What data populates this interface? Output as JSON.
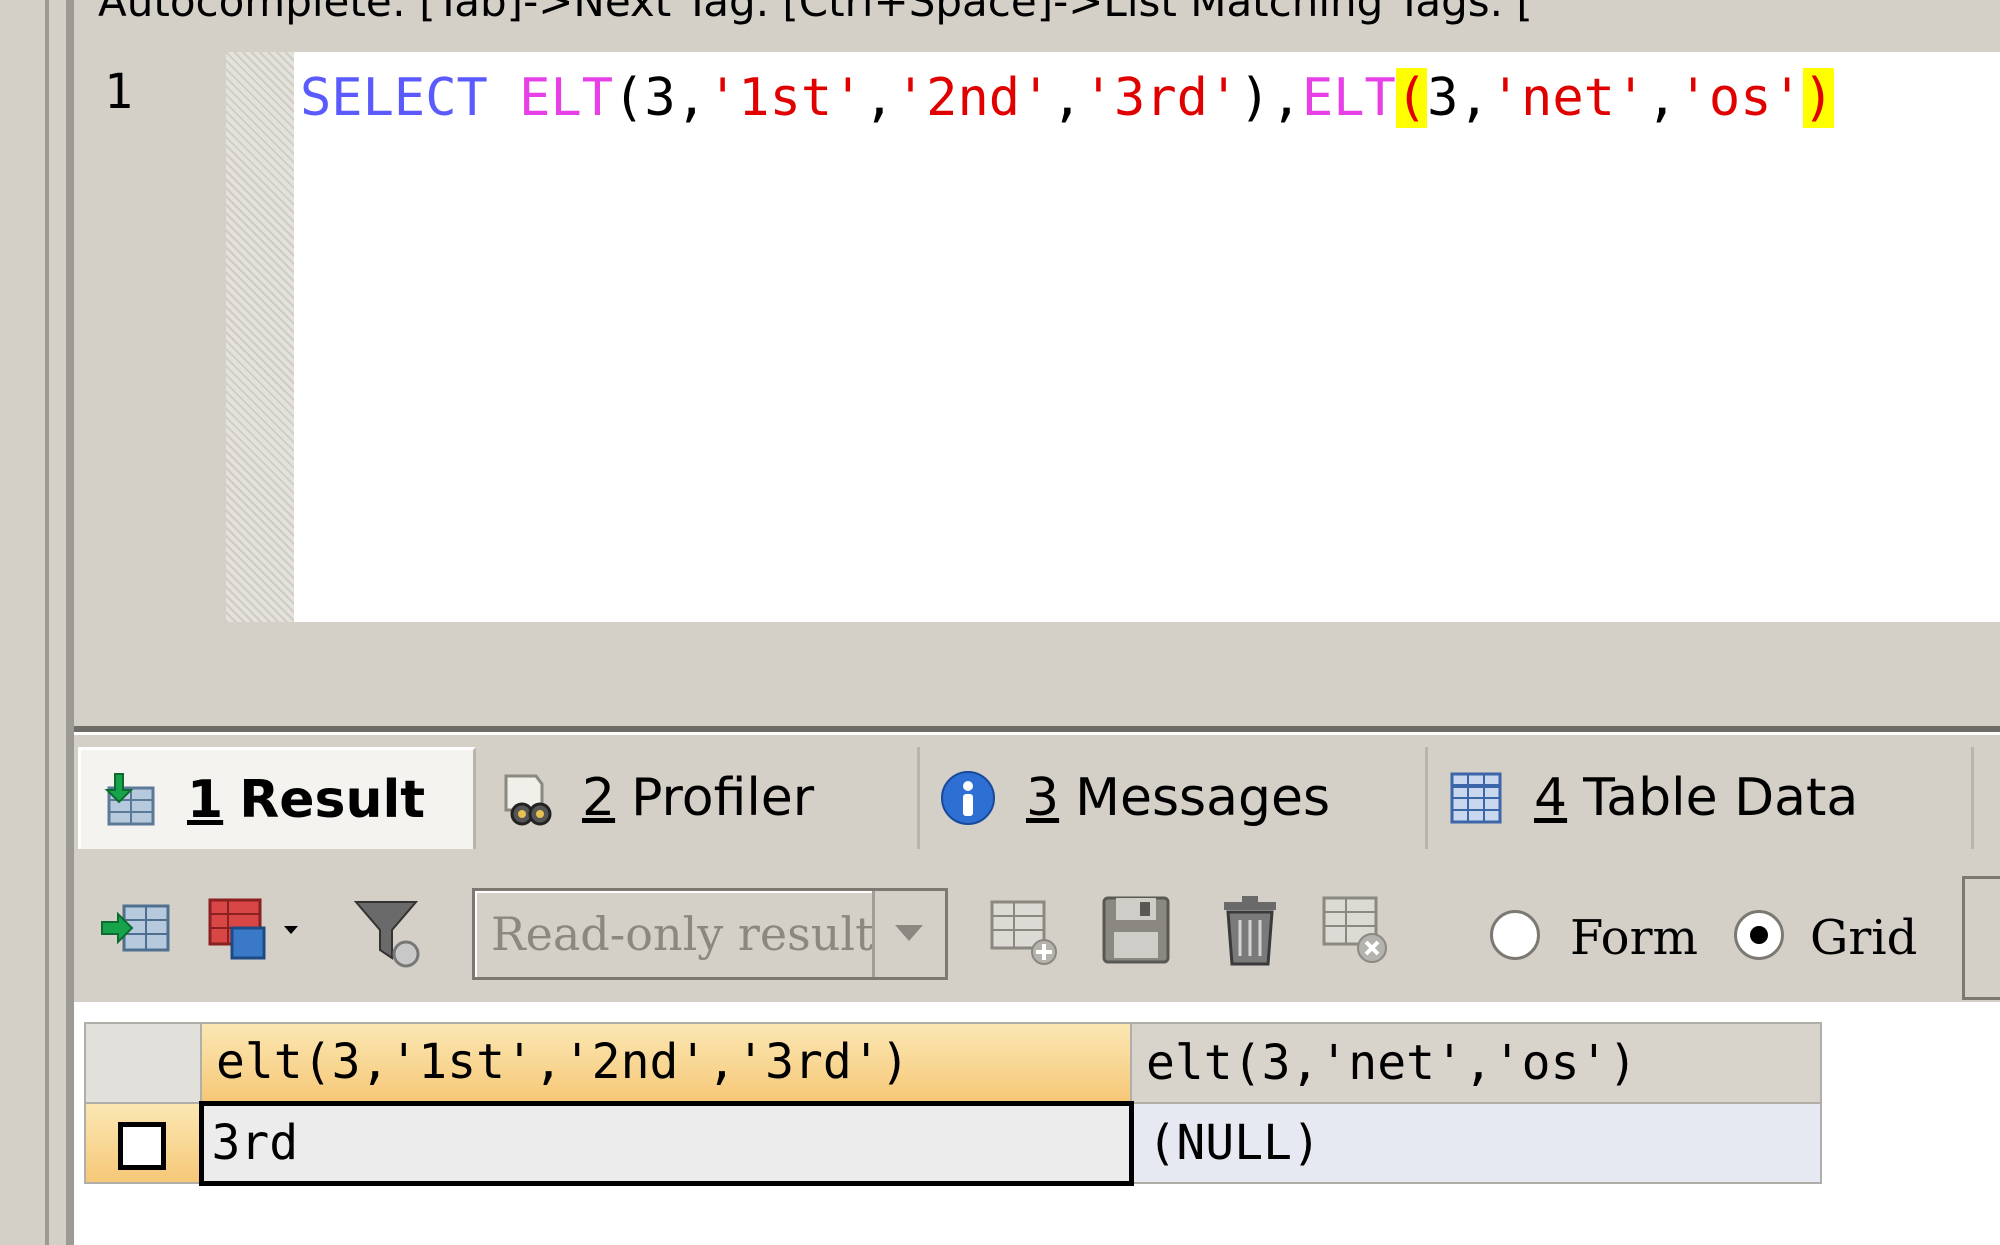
{
  "hint_bar": "Autocomplete: [Tab]->Next Tag. [Ctrl+Space]->List Matching Tags. [",
  "editor": {
    "line_number": "1",
    "tokens": {
      "select": "SELECT",
      "elt1": "ELT",
      "args1_open": "(3,",
      "s1": "'1st'",
      "c1": ",",
      "s2": "'2nd'",
      "c2": ",",
      "s3": "'3rd'",
      "close1": "),",
      "elt2": "ELT",
      "paren_open": "(",
      "num2": "3,",
      "s4": "'net'",
      "c3": ",",
      "s5": "'os'",
      "paren_close": ")"
    }
  },
  "tabs": [
    {
      "number": "1",
      "label": "Result",
      "icon": "result-grid-icon"
    },
    {
      "number": "2",
      "label": "Profiler",
      "icon": "profiler-icon"
    },
    {
      "number": "3",
      "label": "Messages",
      "icon": "info-icon"
    },
    {
      "number": "4",
      "label": "Table Data",
      "icon": "table-data-icon"
    }
  ],
  "toolbar": {
    "readonly_select_value": "Read-only result",
    "radio_form_label": "Form",
    "radio_grid_label": "Grid",
    "selected_mode": "Grid"
  },
  "grid": {
    "columns": [
      "elt(3,'1st','2nd','3rd')",
      "elt(3,'net','os')"
    ],
    "rows": [
      [
        "3rd",
        "(NULL)"
      ]
    ]
  },
  "colors": {
    "keyword": "#5a5aff",
    "function": "#e640e6",
    "string": "#e00000",
    "bracket_highlight": "#ffff00"
  }
}
